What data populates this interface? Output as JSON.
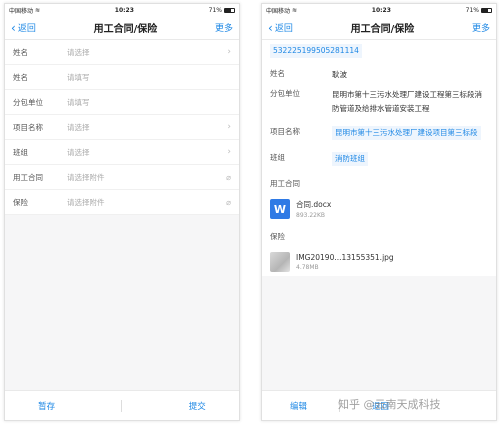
{
  "status": {
    "carrier": "中国移动",
    "time": "10:23",
    "battery": "71%"
  },
  "nav": {
    "back": "返回",
    "title": "用工合同/保险",
    "more": "更多"
  },
  "form": {
    "rows": [
      {
        "label": "姓名",
        "value": "请选择",
        "trail": "chevron"
      },
      {
        "label": "姓名",
        "value": "请填写",
        "trail": ""
      },
      {
        "label": "分包单位",
        "value": "请填写",
        "trail": ""
      },
      {
        "label": "项目名称",
        "value": "请选择",
        "trail": "chevron"
      },
      {
        "label": "班组",
        "value": "请选择",
        "trail": "chevron"
      },
      {
        "label": "用工合同",
        "value": "请选择附件",
        "trail": "clip"
      },
      {
        "label": "保险",
        "value": "请选择附件",
        "trail": "clip"
      }
    ],
    "bottom": {
      "save": "暂存",
      "submit": "提交"
    }
  },
  "detail": {
    "id_number": "532225199505281114",
    "name_label": "姓名",
    "name": "耿波",
    "sub_label": "分包单位",
    "sub": "昆明市第十三污水处理厂建设工程第三标段消防管道及给排水管道安装工程",
    "proj_label": "项目名称",
    "proj": "昆明市第十三污水处理厂建设项目第三标段",
    "team_label": "班组",
    "team": "消防班组",
    "contract_label": "用工合同",
    "contract_file": {
      "name": "合同.docx",
      "size": "893.22KB"
    },
    "insurance_label": "保险",
    "insurance_file": {
      "name": "IMG20190...13155351.jpg",
      "size": "4.78MB"
    },
    "bottom": {
      "edit": "编辑",
      "return": "退回"
    }
  },
  "watermark": "知乎 @云南天成科技",
  "colors": {
    "accent": "#1e88e5"
  }
}
